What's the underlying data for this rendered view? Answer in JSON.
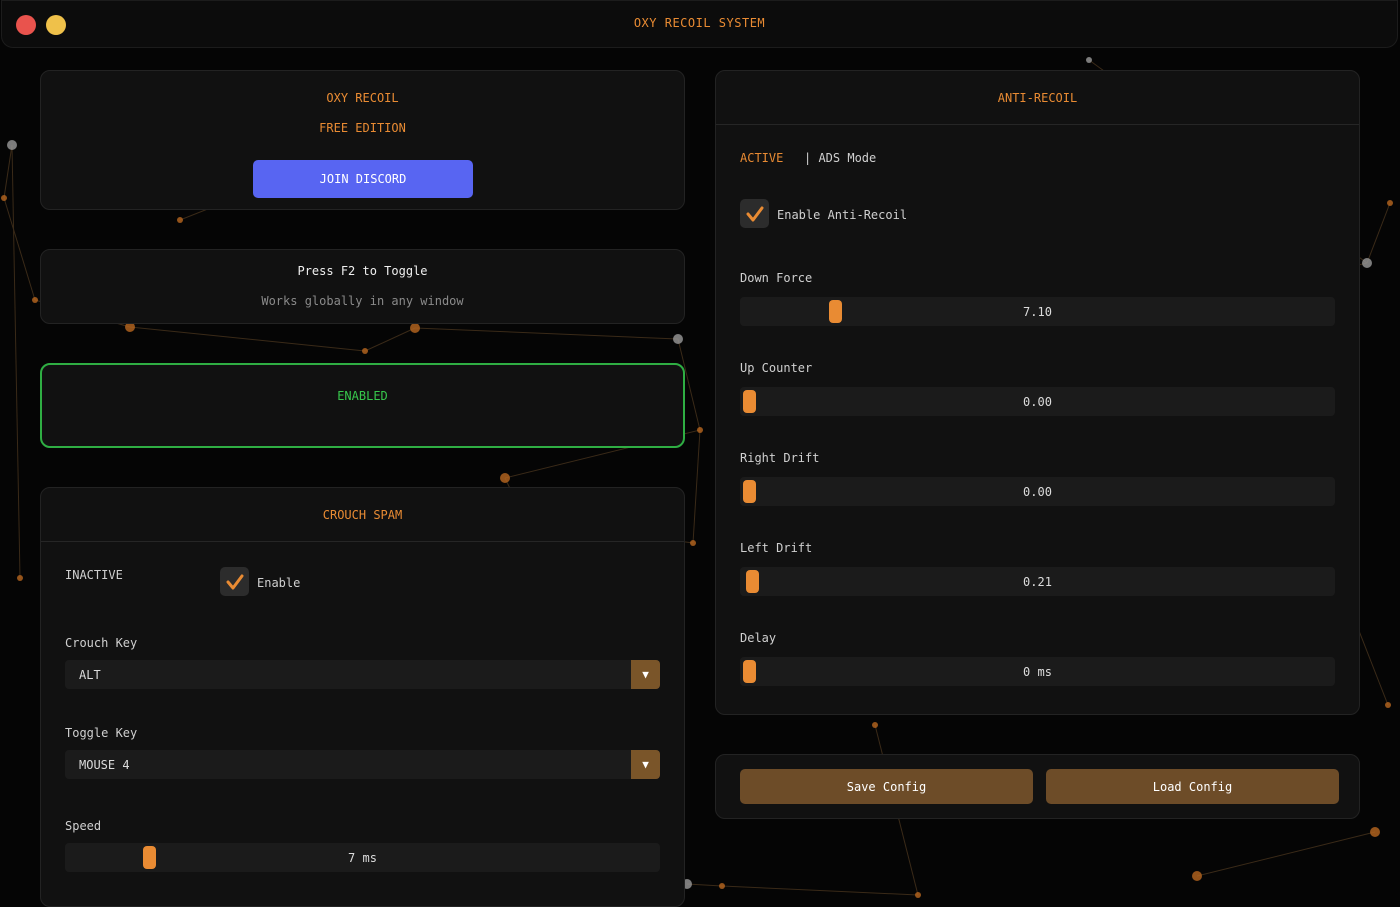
{
  "app": {
    "title": "OXY RECOIL SYSTEM"
  },
  "brand": {
    "name": "OXY RECOIL",
    "edition": "FREE EDITION",
    "discord_button": "JOIN DISCORD"
  },
  "hotkey": {
    "title": "Press F2 to Toggle",
    "subtitle": "Works globally in any window"
  },
  "status": {
    "label": "ENABLED"
  },
  "crouch_spam": {
    "title": "CROUCH SPAM",
    "state": "INACTIVE",
    "enable_label": "Enable",
    "enabled": true,
    "crouch_key_label": "Crouch Key",
    "crouch_key_value": "ALT",
    "toggle_key_label": "Toggle Key",
    "toggle_key_value": "MOUSE 4",
    "speed_label": "Speed",
    "speed_value": "7 ms",
    "speed_fraction": 0.13
  },
  "anti_recoil": {
    "title": "ANTI-RECOIL",
    "state": "ACTIVE",
    "mode": "| ADS Mode",
    "enable_label": "Enable Anti-Recoil",
    "enabled": true,
    "sliders": [
      {
        "label": "Down Force",
        "value": "7.10",
        "fraction": 0.15
      },
      {
        "label": "Up Counter",
        "value": "0.00",
        "fraction": 0.0
      },
      {
        "label": "Right Drift",
        "value": "0.00",
        "fraction": 0.0
      },
      {
        "label": "Left Drift",
        "value": "0.21",
        "fraction": 0.005
      },
      {
        "label": "Delay",
        "value": "0 ms",
        "fraction": 0.0
      }
    ]
  },
  "config": {
    "save_label": "Save Config",
    "load_label": "Load Config"
  },
  "colors": {
    "accent": "#e98b33",
    "enabled_green": "#37c74c",
    "discord": "#5865f2",
    "panel": "#111111"
  }
}
